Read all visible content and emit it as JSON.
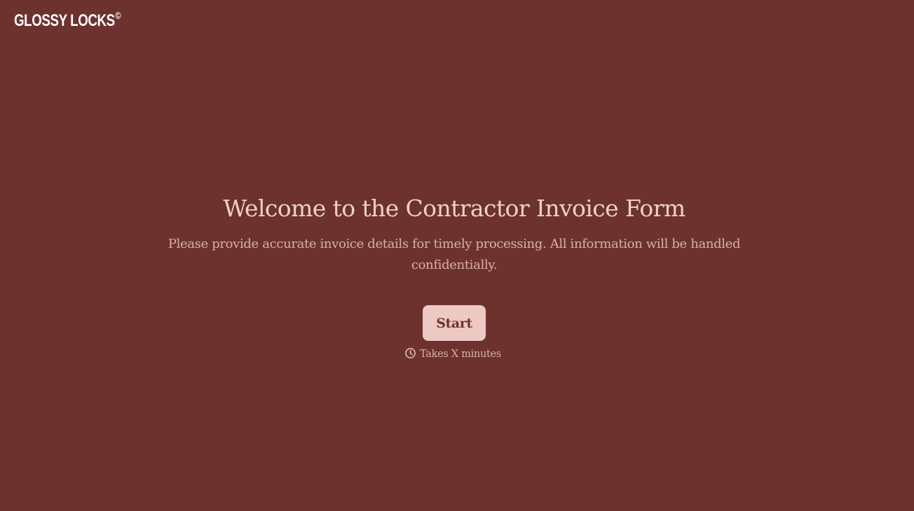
{
  "brand": {
    "logo_text": "GLOSSY LOCKS",
    "logo_mark": "©"
  },
  "welcome": {
    "title": "Welcome to the Contractor Invoice Form",
    "subtitle": "Please provide accurate invoice details for timely processing. All information will be handled confidentially.",
    "start_label": "Start",
    "duration_icon": "clock-icon",
    "duration_text": "Takes X minutes"
  },
  "colors": {
    "background": "#6d322e",
    "title": "#efd0c9",
    "text": "#d6b1a9",
    "button_bg": "#edc9c3",
    "button_text": "#6d322e",
    "logo": "#ffffff"
  }
}
